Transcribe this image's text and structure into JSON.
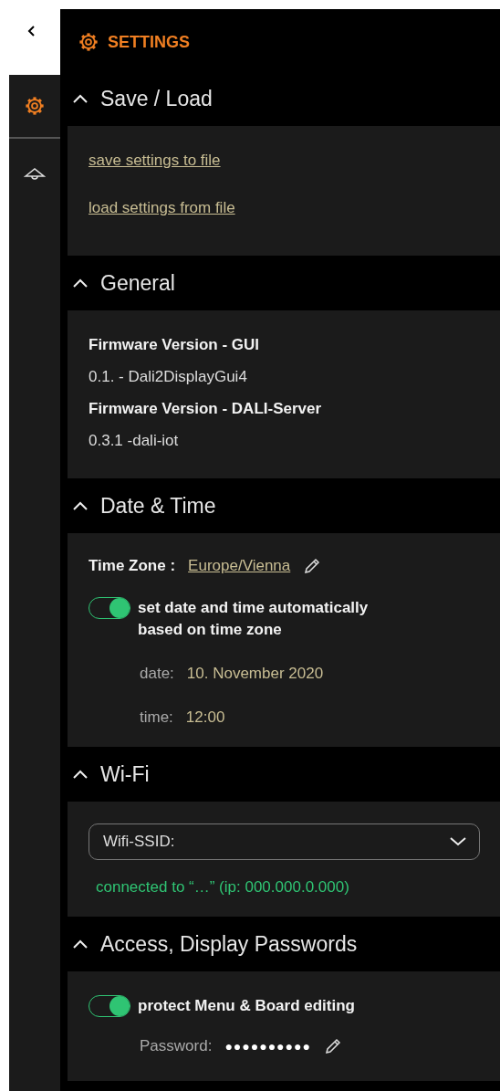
{
  "title": "SETTINGS",
  "sidebar": {
    "items": [
      {
        "kind": "settings",
        "selected": true
      },
      {
        "kind": "lamp",
        "selected": false
      }
    ]
  },
  "sections": [
    {
      "kind": "links",
      "title": "Save / Load",
      "expanded": true,
      "links": [
        "save settings to file",
        "load settings from file"
      ]
    },
    {
      "kind": "info",
      "title": "General",
      "expanded": true,
      "rows": [
        {
          "label": "Firmware Version - GUI",
          "value": "0.1. - Dali2DisplayGui4"
        },
        {
          "label": "Firmware Version - DALI-Server",
          "value": "0.3.1 -dali-iot"
        }
      ]
    },
    {
      "kind": "datetime",
      "title": "Date & Time",
      "expanded": true,
      "time_zone_label": "Time Zone :",
      "time_zone": "Europe/Vienna",
      "toggle": {
        "label": "set date and time automatically based on time zone",
        "on": true
      },
      "fields": [
        {
          "label": "date:",
          "value": "10. November 2020"
        },
        {
          "label": "time:",
          "value": "12:00"
        }
      ]
    },
    {
      "kind": "wifi",
      "title": "Wi-Fi",
      "expanded": true,
      "select_label": "Wifi-SSID:",
      "status": "connected to “…” (ip: 000.000.0.000)"
    },
    {
      "kind": "passwords",
      "title": "Access, Display Passwords",
      "expanded": true,
      "toggle": {
        "label": "protect Menu & Board editing",
        "on": true
      },
      "password_label": "Password:",
      "password": "●●●●●●●●●●"
    }
  ]
}
